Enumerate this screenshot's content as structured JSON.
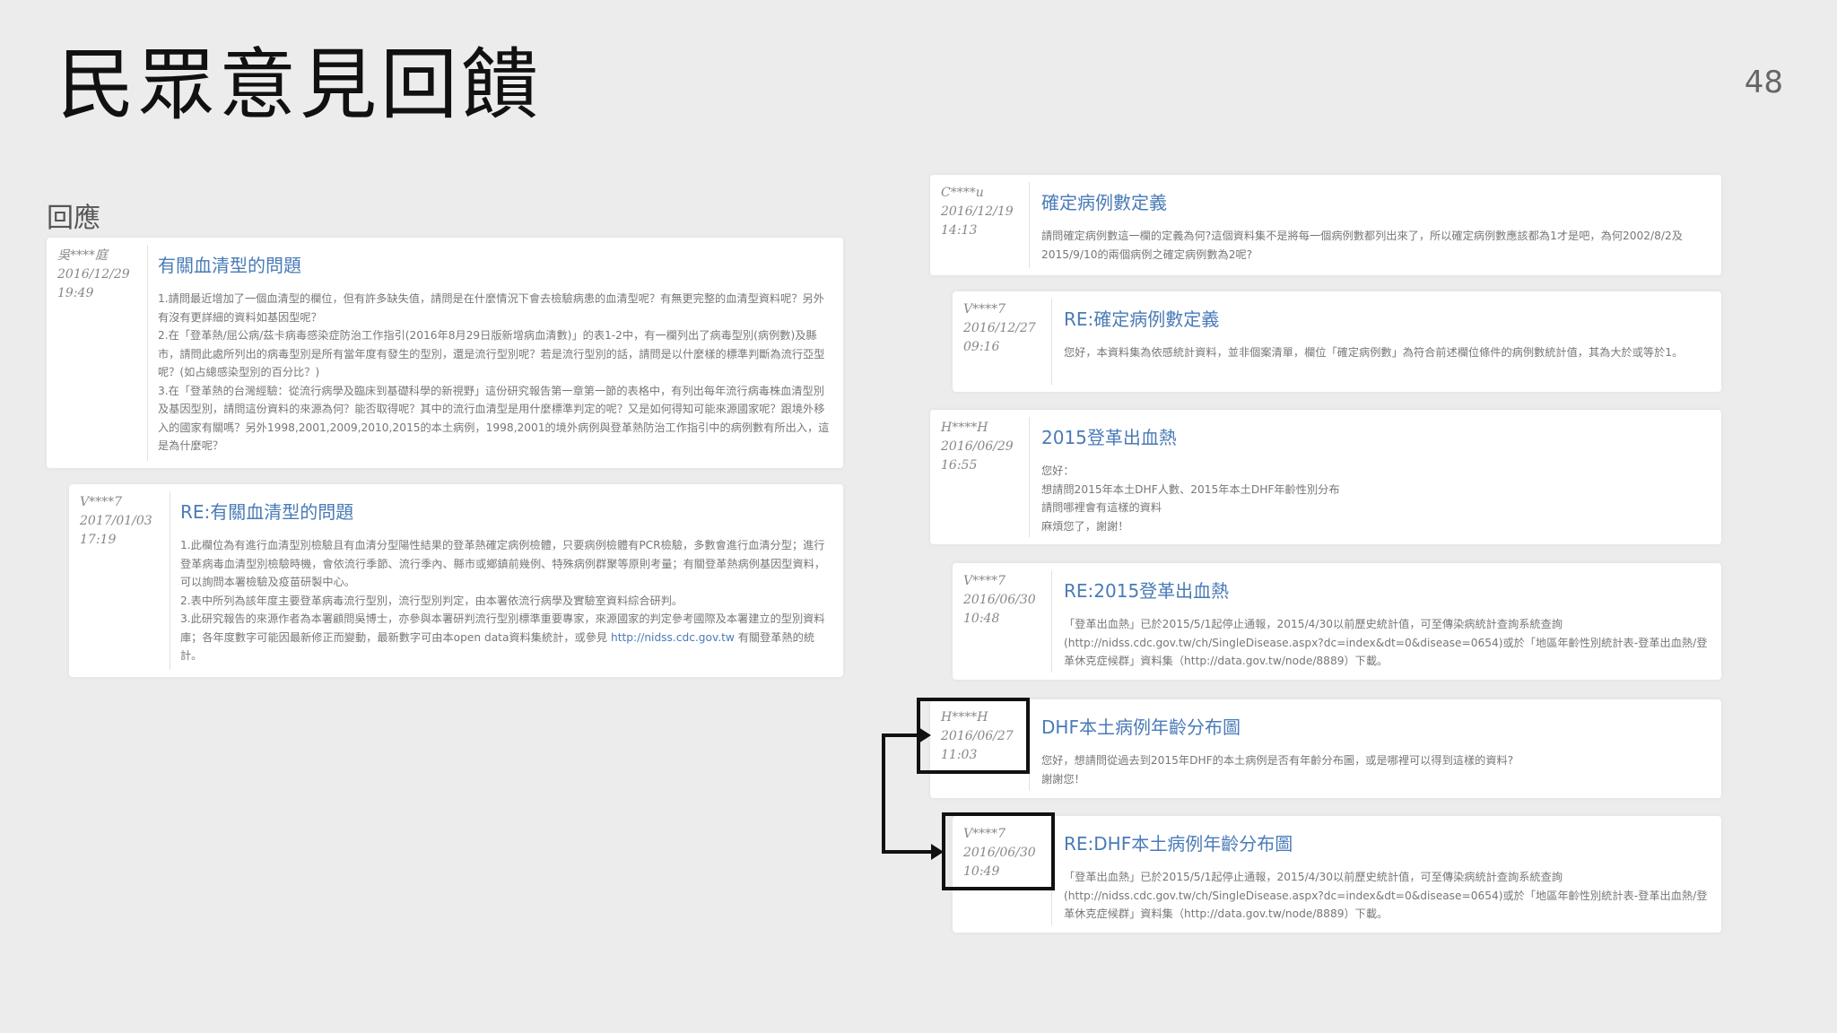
{
  "slide": {
    "title": "民眾意見回饋",
    "page_number": "48",
    "section_label": "回應"
  },
  "left_posts": [
    {
      "user": "吳****庭",
      "date": "2016/12/29",
      "time": "19:49",
      "title": "有關血清型的問題",
      "body": [
        "1.請問最近增加了一個血清型的欄位，但有許多缺失值，請問是在什麼情況下會去檢驗病患的血清型呢？有無更完整的血清型資料呢？另外有沒有更詳細的資料如基因型呢？",
        "2.在「登革熱/屈公病/茲卡病毒感染症防治工作指引(2016年8月29日版新增病血清數)」的表1-2中，有一欄列出了病毒型別(病例數)及縣市，請問此處所列出的病毒型別是所有當年度有發生的型別，還是流行型別呢？若是流行型別的話，請問是以什麼樣的標準判斷為流行亞型呢？(如占總感染型別的百分比？)",
        "3.在「登革熱的台灣經驗：從流行病學及臨床到基礎科學的新視野」這份研究報告第一章第一節的表格中，有列出每年流行病毒株血清型別及基因型別，請問這份資料的來源為何？能否取得呢？其中的流行血清型是用什麼標準判定的呢？又是如何得知可能來源國家呢？跟境外移入的國家有關嗎？另外1998,2001,2009,2010,2015的本土病例，1998,2001的境外病例與登革熱防治工作指引中的病例數有所出入，這是為什麼呢？"
      ]
    },
    {
      "user": "V****7",
      "date": "2017/01/03",
      "time": "17:19",
      "title": "RE:有關血清型的問題",
      "body": [
        "1.此欄位為有進行血清型別檢驗且有血清分型陽性結果的登革熱確定病例檢體，只要病例檢體有PCR檢驗，多數會進行血清分型；進行登革病毒血清型別檢驗時機，會依流行季節、流行季內、縣市或鄉鎮前幾例、特殊病例群聚等原則考量；有關登革熱病例基因型資料，可以詢問本署檢驗及疫苗研製中心。",
        "2.表中所列為該年度主要登革病毒流行型別，流行型別判定，由本署依流行病學及實驗室資料綜合研判。",
        "3.此研究報告的來源作者為本署顧問吳博士，亦參與本署研判流行型別標準重要專家，來源國家的判定參考國際及本署建立的型別資料庫；各年度數字可能因最新修正而變動，最新數字可由本open data資料集統計，或參見"
      ],
      "link": "http://nidss.cdc.gov.tw",
      "link_suffix": "有關登革熱的統計。"
    }
  ],
  "right_posts": [
    {
      "user": "C****u",
      "date": "2016/12/19",
      "time": "14:13",
      "title": "確定病例數定義",
      "body": [
        "請問確定病例數這一欄的定義為何?這個資料集不是將每一個病例數都列出來了，所以確定病例數應該都為1才是吧，為何2002/8/2及2015/9/10的兩個病例之確定病例數為2呢?"
      ]
    },
    {
      "user": "V****7",
      "date": "2016/12/27",
      "time": "09:16",
      "title": "RE:確定病例數定義",
      "body": [
        "您好，本資料集為依感統計資料，並非個案清單，欄位「確定病例數」為符合前述欄位條件的病例數統計值，其為大於或等於1。"
      ]
    },
    {
      "user": "H****H",
      "date": "2016/06/29",
      "time": "16:55",
      "title": "2015登革出血熱",
      "body": [
        "您好：",
        "想請問2015年本土DHF人數、2015年本土DHF年齡性別分布",
        "請問哪裡會有這樣的資料",
        "麻煩您了，謝謝！"
      ]
    },
    {
      "user": "V****7",
      "date": "2016/06/30",
      "time": "10:48",
      "title": "RE:2015登革出血熱",
      "body": [
        "「登革出血熱」已於2015/5/1起停止通報，2015/4/30以前歷史統計值，可至傳染病統計查詢系統查詢(http://nidss.cdc.gov.tw/ch/SingleDisease.aspx?dc=index&dt=0&disease=0654)或於「地區年齡性別統計表-登革出血熱/登革休克症候群」資料集（http://data.gov.tw/node/8889）下載。"
      ]
    },
    {
      "user": "H****H",
      "date": "2016/06/27",
      "time": "11:03",
      "title": "DHF本土病例年齡分布圖",
      "body": [
        "您好，想請問從過去到2015年DHF的本土病例是否有年齡分布圖，或是哪裡可以得到這樣的資料?",
        "謝謝您！"
      ]
    },
    {
      "user": "V****7",
      "date": "2016/06/30",
      "time": "10:49",
      "title": "RE:DHF本土病例年齡分布圖",
      "body": [
        "「登革出血熱」已於2015/5/1起停止通報，2015/4/30以前歷史統計值，可至傳染病統計查詢系統查詢(http://nidss.cdc.gov.tw/ch/SingleDisease.aspx?dc=index&dt=0&disease=0654)或於「地區年齡性別統計表-登革出血熱/登革休克症候群」資料集（http://data.gov.tw/node/8889）下載。"
      ]
    }
  ]
}
